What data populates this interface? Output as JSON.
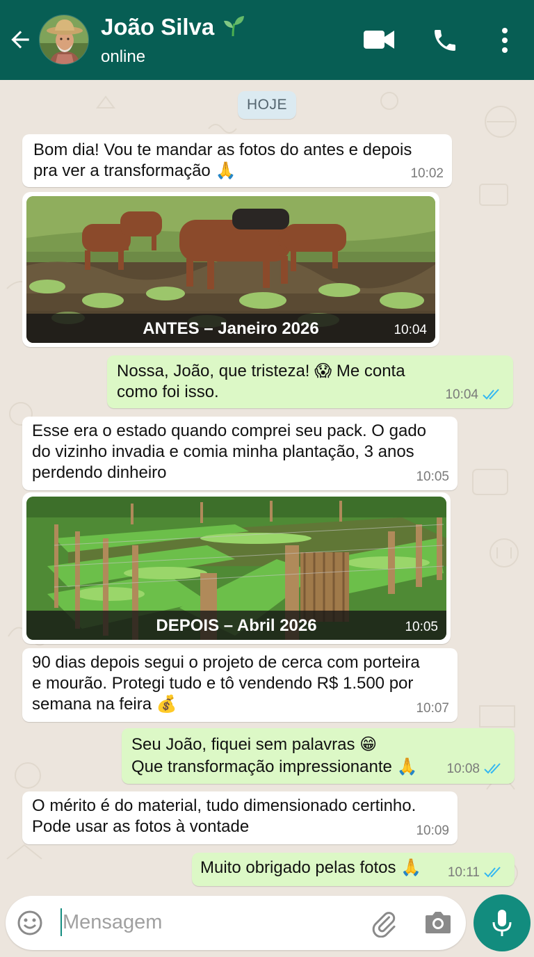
{
  "header": {
    "name": "João Silva",
    "status": "online"
  },
  "chat": {
    "date_chip": "HOJE",
    "messages": [
      {
        "direction": "in",
        "text": "Bom dia! Vou te mandar as fotos do antes e depois pra ver a transformação 🙏",
        "lines": [
          "Bom dia! Vou te mandar as fotos do antes e depois",
          "pra ver a transformação 🙏"
        ],
        "time": "10:02"
      },
      {
        "direction": "in",
        "type": "image",
        "caption": "ANTES – Janeiro 2026",
        "time": "10:04"
      },
      {
        "direction": "out",
        "lines": [
          "Nossa, João, que tristeza! 😱 Me conta",
          "como foi isso."
        ],
        "time": "10:04",
        "status": "read"
      },
      {
        "direction": "in",
        "lines": [
          "Esse era o estado quando comprei seu pack. O gado",
          "do vizinho invadia e comia minha plantação, 3 anos",
          "perdendo dinheiro"
        ],
        "time": "10:05"
      },
      {
        "direction": "in",
        "type": "image",
        "caption": "DEPOIS – Abril 2026",
        "time": "10:05"
      },
      {
        "direction": "in",
        "lines": [
          "90 dias depois segui o projeto de cerca com porteira",
          "e mourão. Protegi tudo e tô vendendo R$ 1.500 por",
          "semana na feira 💰"
        ],
        "time": "10:07"
      },
      {
        "direction": "out",
        "lines": [
          "Seu João, fiquei sem palavras 😁",
          "Que transformação impressionante 🙏"
        ],
        "time": "10:08",
        "status": "read"
      },
      {
        "direction": "in",
        "lines": [
          "O mérito é do material, tudo dimensionado certinho.",
          "Pode usar as fotos à vontade"
        ],
        "time": "10:09"
      },
      {
        "direction": "out",
        "lines": [
          "Muito obrigado pelas fotos 🙏"
        ],
        "time": "10:11",
        "status": "read"
      }
    ]
  },
  "composer": {
    "placeholder": "Mensagem"
  },
  "icons": {
    "back": "arrow-left-icon",
    "video": "video-camera-icon",
    "call": "phone-icon",
    "menu": "more-vertical-icon",
    "emoji": "emoji-icon",
    "attach": "paperclip-icon",
    "camera": "camera-icon",
    "mic": "microphone-icon",
    "sprout": "sprout-icon"
  },
  "colors": {
    "header": "#075e54",
    "incoming": "#ffffff",
    "outgoing": "#dcf8c6",
    "accent": "#128c7e",
    "read_ticks": "#34b7f1"
  }
}
